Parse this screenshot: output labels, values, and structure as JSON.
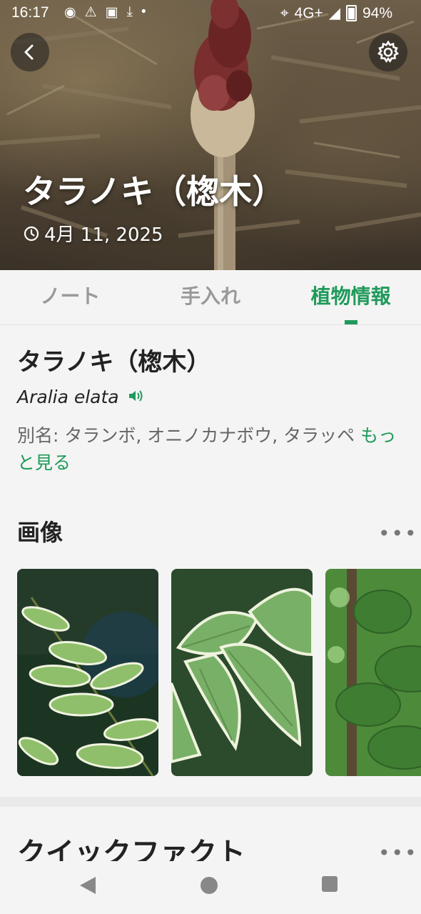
{
  "status_bar": {
    "time": "16:17",
    "network": "4G+",
    "battery": "94%"
  },
  "hero": {
    "title": "タラノキ（楤木）",
    "date": "4月 11, 2025"
  },
  "tabs": [
    {
      "label": "ノート",
      "active": false
    },
    {
      "label": "手入れ",
      "active": false
    },
    {
      "label": "植物情報",
      "active": true
    }
  ],
  "plant": {
    "name": "タラノキ（楤木）",
    "scientific_name": "Aralia elata",
    "aliases_text": "別名: タランボ, オニノカナボウ, タラッペ",
    "more_link": "もっと見る"
  },
  "images_section": {
    "title": "画像",
    "more": "•••"
  },
  "quick_facts": {
    "title": "クイックファクト",
    "more": "•••"
  },
  "colors": {
    "accent": "#1f9a5a",
    "text": "#222222",
    "muted": "#9a9a9a"
  },
  "icons": [
    "back-arrow-icon",
    "gear-icon",
    "clock-icon",
    "speaker-icon",
    "nav-back-icon",
    "nav-home-icon",
    "nav-recents-icon"
  ]
}
